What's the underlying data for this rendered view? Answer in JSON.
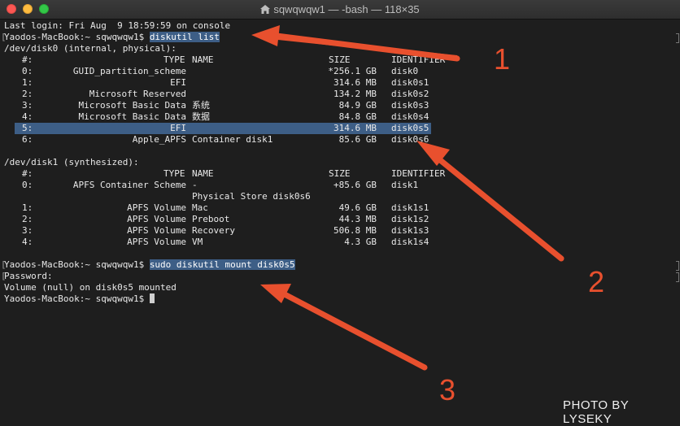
{
  "window": {
    "title": "sqwqwqw1 — -bash — 118×35"
  },
  "terminal": {
    "login": "Last login: Fri Aug  9 18:59:59 on console",
    "prompt1": "Yaodos-MacBook:~ sqwqwqw1$ ",
    "cmd1": "diskutil list",
    "disk0_header": "/dev/disk0 (internal, physical):",
    "table_headers": {
      "num": "#:",
      "type": "TYPE",
      "name": "NAME",
      "size": "SIZE",
      "identifier": "IDENTIFIER"
    },
    "disk0_rows": [
      {
        "num": "0:",
        "type": "GUID_partition_scheme",
        "name": "",
        "size": "*256.1 GB",
        "id": "disk0"
      },
      {
        "num": "1:",
        "type": "EFI",
        "name": "",
        "size": "314.6 MB",
        "id": "disk0s1"
      },
      {
        "num": "2:",
        "type": "Microsoft Reserved",
        "name": "",
        "size": "134.2 MB",
        "id": "disk0s2"
      },
      {
        "num": "3:",
        "type": "Microsoft Basic Data",
        "name": "系统",
        "size": "84.9 GB",
        "id": "disk0s3"
      },
      {
        "num": "4:",
        "type": "Microsoft Basic Data",
        "name": "数据",
        "size": "84.8 GB",
        "id": "disk0s4"
      },
      {
        "num": "5:",
        "type": "EFI",
        "name": "",
        "size": "314.6 MB",
        "id": "disk0s5"
      },
      {
        "num": "6:",
        "type": "Apple_APFS",
        "name": "Container disk1",
        "size": "85.6 GB",
        "id": "disk0s6"
      }
    ],
    "disk1_header": "/dev/disk1 (synthesized):",
    "disk1_rows": [
      {
        "num": "0:",
        "type": "APFS Container Scheme",
        "name": "-",
        "size": "+85.6 GB",
        "id": "disk1"
      },
      {
        "num": "",
        "type": "",
        "name": "Physical Store disk0s6",
        "size": "",
        "id": ""
      },
      {
        "num": "1:",
        "type": "APFS Volume",
        "name": "Mac",
        "size": "49.6 GB",
        "id": "disk1s1"
      },
      {
        "num": "2:",
        "type": "APFS Volume",
        "name": "Preboot",
        "size": "44.3 MB",
        "id": "disk1s2"
      },
      {
        "num": "3:",
        "type": "APFS Volume",
        "name": "Recovery",
        "size": "506.8 MB",
        "id": "disk1s3"
      },
      {
        "num": "4:",
        "type": "APFS Volume",
        "name": "VM",
        "size": "4.3 GB",
        "id": "disk1s4"
      }
    ],
    "prompt2": "Yaodos-MacBook:~ sqwqwqw1$ ",
    "cmd2": "sudo diskutil mount disk0s5",
    "password": "Password:",
    "mounted": "Volume (null) on disk0s5 mounted",
    "prompt3": "Yaodos-MacBook:~ sqwqwqw1$ "
  },
  "annotations": {
    "n1": "1",
    "n2": "2",
    "n3": "3",
    "color": "#e8502e"
  },
  "watermark": "PHOTO BY LYSEKY"
}
